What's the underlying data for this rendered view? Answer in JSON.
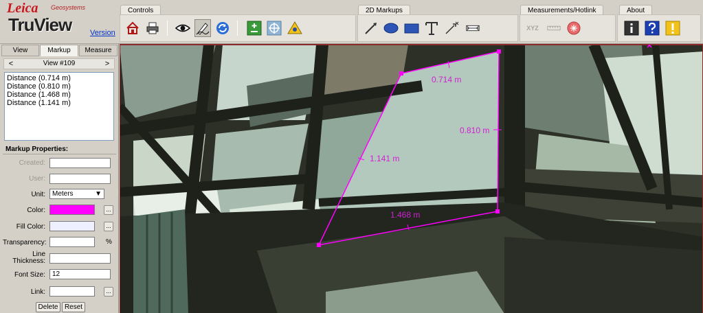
{
  "logo": {
    "brand": "Leica",
    "subbrand": "Geosystems",
    "product": "TruView",
    "version_link": "Version"
  },
  "toolbar_groups": {
    "controls": "Controls",
    "markups_2d": "2D Markups",
    "measurements": "Measurements/Hotlink",
    "about": "About"
  },
  "toolbar_icons": {
    "controls": [
      "home-icon",
      "print-icon",
      "eye-icon",
      "pen-icon",
      "refresh-icon",
      "zoom-plus-icon",
      "pan-icon",
      "warning-triangle-icon"
    ],
    "markups": [
      "line-tool-icon",
      "ellipse-tool-icon",
      "rectangle-tool-icon",
      "text-tool-icon",
      "arrow-tool-icon",
      "dimension-tool-icon"
    ],
    "measurements": [
      "xyz-icon",
      "distance-ruler-icon",
      "hotlink-icon"
    ],
    "about": [
      "info-icon",
      "help-icon",
      "alert-icon"
    ]
  },
  "measure_text": {
    "xyz": "XYZ"
  },
  "left_tabs": [
    "View",
    "Markup",
    "Measure"
  ],
  "active_tab": "Markup",
  "view_nav": {
    "prev": "<",
    "label": "View #109",
    "next": ">"
  },
  "markup_list": [
    "Distance (0.714 m)",
    "Distance (0.810 m)",
    "Distance (1.468 m)",
    "Distance (1.141 m)"
  ],
  "markup_properties": {
    "header": "Markup Properties:",
    "created_label": "Created:",
    "created_value": "",
    "user_label": "User:",
    "user_value": "",
    "unit_label": "Unit:",
    "unit_value": "Meters",
    "color_label": "Color:",
    "color_value": "#ff00ff",
    "fill_color_label": "Fill Color:",
    "fill_color_value": "#eef0ff",
    "transparency_label": "Transparency:",
    "transparency_value": "",
    "transparency_unit": "%",
    "line_thickness_label": "Line\nThickness:",
    "line_thickness_value": "",
    "font_size_label": "Font Size:",
    "font_size_value": "12",
    "link_label": "Link:",
    "link_value": "",
    "browse_label": "...",
    "delete_button": "Delete",
    "reset_button": "Reset"
  },
  "measurements": [
    {
      "label": "0.714 m"
    },
    {
      "label": "0.810 m"
    },
    {
      "label": "1.468 m"
    },
    {
      "label": "1.141 m"
    }
  ],
  "colors": {
    "markup": "#ff00ff",
    "markup_text": "#d020d0",
    "toolbar_bg": "#d4d0c8",
    "viewer_border": "#8a2a2a"
  }
}
